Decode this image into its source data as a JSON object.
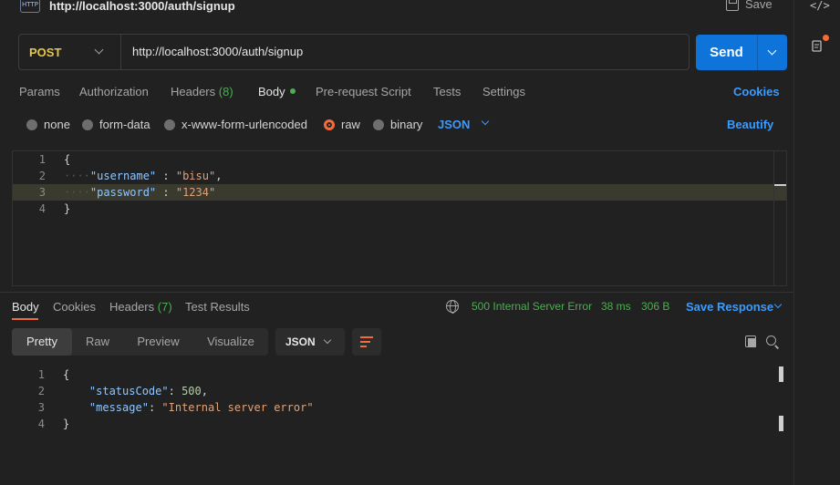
{
  "title": {
    "badge": "HTTP",
    "text": "http://localhost:3000/auth/signup",
    "save_label": "Save"
  },
  "request": {
    "method": "POST",
    "url": "http://localhost:3000/auth/signup",
    "send_label": "Send"
  },
  "req_tabs": {
    "params": "Params",
    "authorization": "Authorization",
    "headers": "Headers",
    "headers_count": "(8)",
    "body": "Body",
    "pre_request": "Pre-request Script",
    "tests": "Tests",
    "settings": "Settings",
    "cookies": "Cookies"
  },
  "body_types": {
    "none": "none",
    "form_data": "form-data",
    "urlencoded": "x-www-form-urlencoded",
    "raw": "raw",
    "binary": "binary",
    "language": "JSON",
    "beautify": "Beautify",
    "selected": "raw"
  },
  "request_body": {
    "line_numbers": [
      "1",
      "2",
      "3",
      "4"
    ],
    "open_brace": "{",
    "close_brace": "}",
    "key1": "\"username\"",
    "val1": "\"bisu\"",
    "key2": "\"password\"",
    "val2": "\"1234\"",
    "sep": " : ",
    "comma": ","
  },
  "response": {
    "tabs": {
      "body": "Body",
      "cookies": "Cookies",
      "headers": "Headers",
      "headers_count": "(7)",
      "test_results": "Test Results"
    },
    "status": "500 Internal Server Error",
    "time": "38 ms",
    "size": "306 B",
    "save_response": "Save Response",
    "views": {
      "pretty": "Pretty",
      "raw": "Raw",
      "preview": "Preview",
      "visualize": "Visualize"
    },
    "format": "JSON",
    "line_numbers": [
      "1",
      "2",
      "3",
      "4"
    ],
    "open_brace": "{",
    "close_brace": "}",
    "key1": "\"statusCode\"",
    "val1": "500",
    "key2": "\"message\"",
    "val2": "\"Internal server error\"",
    "sep": ": ",
    "comma": ","
  },
  "sidebar": {
    "code_icon_glyph": "</>"
  },
  "colors": {
    "accent_orange": "#f26b3a",
    "link_blue": "#3b9cff",
    "send_blue": "#0e74d9",
    "method_yellow": "#e5c84a",
    "success_green": "#4caf50"
  }
}
